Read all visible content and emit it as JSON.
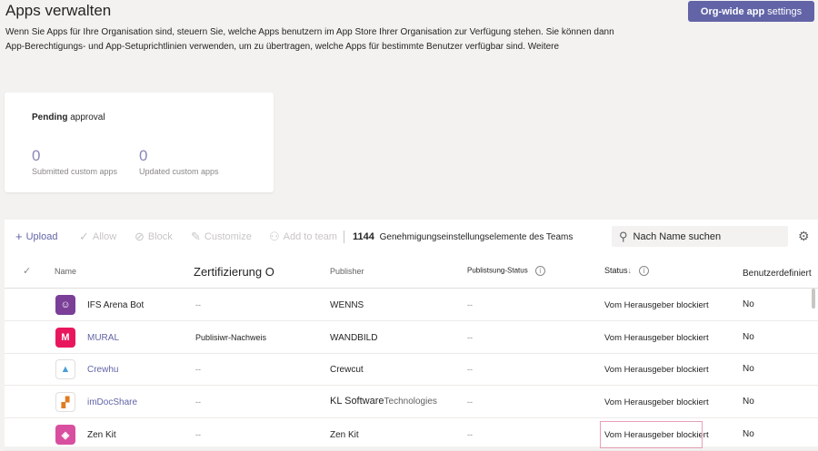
{
  "page": {
    "title": "Apps verwalten",
    "description": "Wenn Sie Apps für Ihre Organisation sind, steuern Sie, welche Apps benutzern im App Store Ihrer Organisation zur Verfügung stehen. Sie können dann App-Berechtigungs- und App-Setuprichtlinien verwenden, um zu übertragen, welche Apps für bestimmte Benutzer verfügbar sind.",
    "more_link": "Weitere",
    "org_button_bold": "Org-wide app",
    "org_button_light": "settings",
    "accent": "#6264a7"
  },
  "pending": {
    "title_bold": "Pending",
    "title_rest": "approval",
    "submitted_value": "0",
    "submitted_label": "Submitted custom apps",
    "updated_value": "0",
    "updated_label": "Updated custom apps"
  },
  "toolbar": {
    "upload": "Upload",
    "allow": "Allow",
    "block": "Block",
    "customize": "Customize",
    "add_to_team": "Add to team",
    "count": "1144",
    "count_label": "Genehmigungseinstellungselemente des Teams",
    "search_placeholder": "Nach Name suchen"
  },
  "columns": {
    "name": "Name",
    "certification": "Zertifizierung O",
    "publisher": "Publisher",
    "publishing_status": "Publistsung-Status",
    "status": "Status",
    "custom": "Benutzerdefiniert"
  },
  "rows": [
    {
      "icon_name": "ifs-arena-bot-icon",
      "icon_glyph": "☺",
      "icon_color": "#7b3f98",
      "name": "IFS Arena Bot",
      "name_style": "plain",
      "certification": "--",
      "publisher": "WENNS",
      "publishing_status": "--",
      "status": "Vom Herausgeber blockiert",
      "custom": "No"
    },
    {
      "icon_name": "mural-icon",
      "icon_glyph": "M",
      "icon_color": "#e8175d",
      "name": "MURAL",
      "name_style": "link",
      "certification": "Publisiwr-Nachweis",
      "publisher": "WANDBILD",
      "publishing_status": "--",
      "status": "Vom Herausgeber blockiert",
      "custom": "No"
    },
    {
      "icon_name": "crewhu-icon",
      "icon_glyph": "▲",
      "icon_color": "#ffffff",
      "name": "Crewhu",
      "name_style": "link",
      "certification": "--",
      "publisher": "Crewcut",
      "publishing_status": "--",
      "status": "Vom Herausgeber blockiert",
      "custom": "No"
    },
    {
      "icon_name": "imdocshare-icon",
      "icon_glyph": "▞",
      "icon_color": "#ffffff",
      "name": "imDocShare",
      "name_style": "link",
      "certification": "--",
      "publisher_main": "KL Software",
      "publisher_rest": "Technologies",
      "publishing_status": "--",
      "status": "Vom Herausgeber blockiert",
      "custom": "No"
    },
    {
      "icon_name": "zen-kit-icon",
      "icon_glyph": "◈",
      "icon_color": "#d94fa0",
      "name": "Zen Kit",
      "name_style": "plain",
      "certification": "--",
      "publisher": "Zen Kit",
      "publishing_status": "--",
      "status": "Vom Herausgeber blockiert",
      "custom": "No"
    }
  ]
}
